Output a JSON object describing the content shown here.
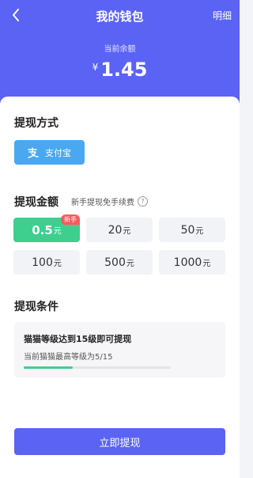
{
  "header": {
    "title": "我的钱包",
    "detail_label": "明细",
    "balance_label": "当前余额",
    "currency_symbol": "¥",
    "balance": "1.45"
  },
  "method": {
    "section_title": "提现方式",
    "option_label": "支付宝",
    "option_icon": "alipay-icon"
  },
  "amount": {
    "section_title": "提现金额",
    "hint": "新手提现免手续费",
    "unit": "元",
    "badge": "新手",
    "options": [
      {
        "value": "0.5",
        "selected": true
      },
      {
        "value": "20"
      },
      {
        "value": "50"
      },
      {
        "value": "100"
      },
      {
        "value": "500"
      },
      {
        "value": "1000"
      }
    ]
  },
  "condition": {
    "section_title": "提现条件",
    "requirement": "猫猫等级达到15级即可提现",
    "status": "当前猫猫最高等级为5/15",
    "progress": 0.333
  },
  "submit_label": "立即提现",
  "colors": {
    "primary": "#5b63f5",
    "selected": "#3ecf8e",
    "alipay": "#4aa8f0",
    "badge": "#ff5a5a"
  }
}
